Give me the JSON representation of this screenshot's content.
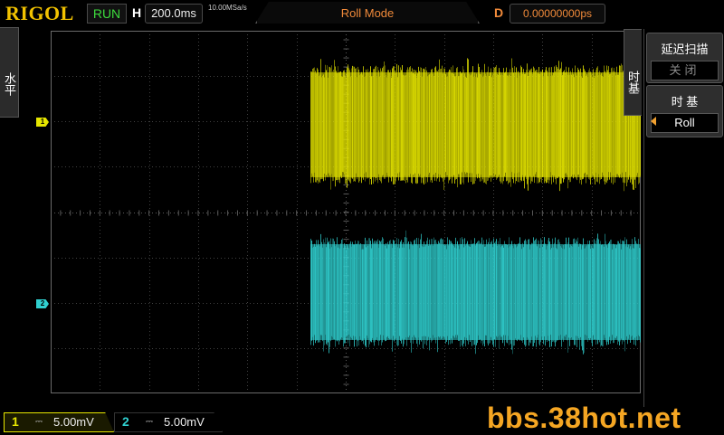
{
  "header": {
    "brand": "RIGOL",
    "run_state": "RUN",
    "h_label": "H",
    "h_timebase": "200.0ms",
    "sample_rate": "10.00MSa/s",
    "mode": "Roll Mode",
    "d_label": "D",
    "d_delay": "0.00000000ps"
  },
  "left_tab": {
    "label": "水平"
  },
  "right_tab": {
    "label": "时基"
  },
  "menu": {
    "delayed_sweep": {
      "title": "延迟扫描",
      "value": "关闭"
    },
    "timebase": {
      "title": "时 基",
      "value": "Roll"
    }
  },
  "channels": {
    "ch1": {
      "marker": "1",
      "label": "1",
      "scale": "5.00mV",
      "color": "#e6e600"
    },
    "ch2": {
      "marker": "2",
      "label": "2",
      "scale": "5.00mV",
      "color": "#30d0d0"
    }
  },
  "watermark": "bbs.38hot.net"
}
